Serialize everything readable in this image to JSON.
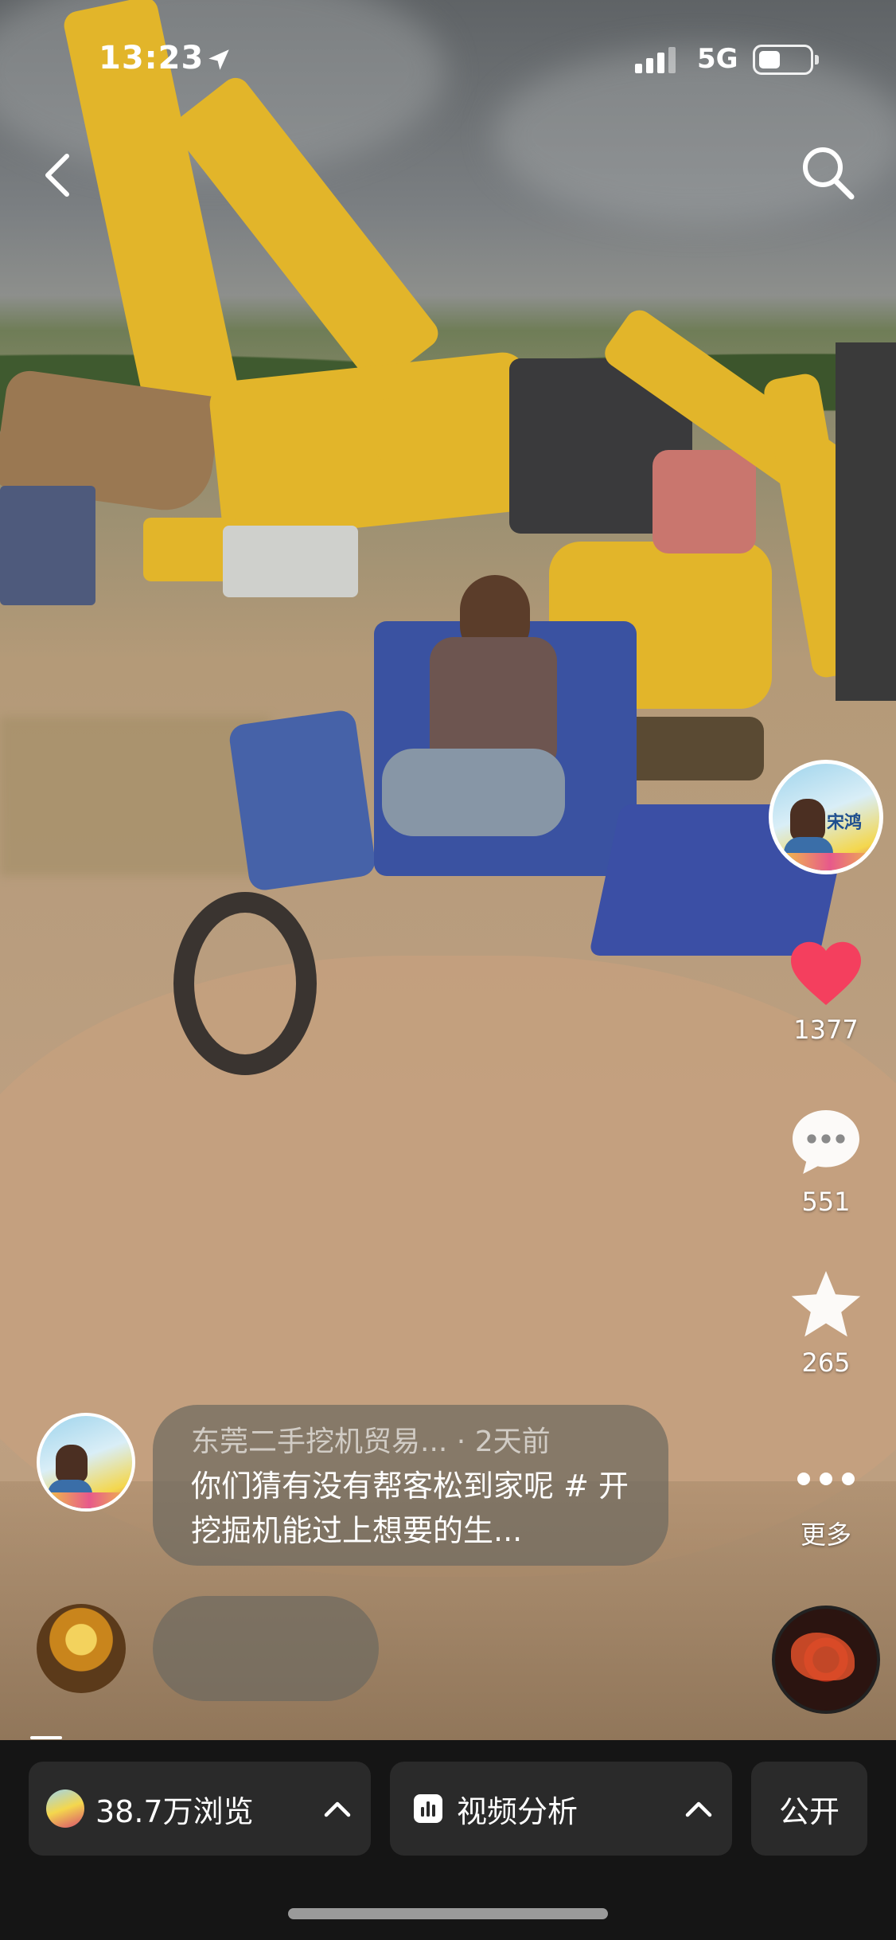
{
  "status_bar": {
    "time": "13:23",
    "network": "5G"
  },
  "rail": {
    "likes": "1377",
    "comments": "551",
    "favorites": "265",
    "more_label": "更多",
    "avatar_badge": "宋鸿"
  },
  "caption": {
    "author": "东莞二手挖机贸易...",
    "dot": "·",
    "time_ago": "2天前",
    "text": "你们猜有没有帮客松到家呢 # 开挖掘机能过上想要的生..."
  },
  "bottom_bar": {
    "views_label": "38.7万浏览",
    "analysis_label": "视频分析",
    "public_label": "公开"
  },
  "colors": {
    "like": "#f43f5e",
    "bar_bg": "#151515",
    "button_bg": "#2a2a2a"
  },
  "icons": [
    "back-icon",
    "search-icon",
    "location-arrow-icon",
    "signal-icon",
    "battery-icon",
    "heart-icon",
    "comment-icon",
    "star-icon",
    "more-dots-icon",
    "chevron-up-icon",
    "chart-icon"
  ]
}
